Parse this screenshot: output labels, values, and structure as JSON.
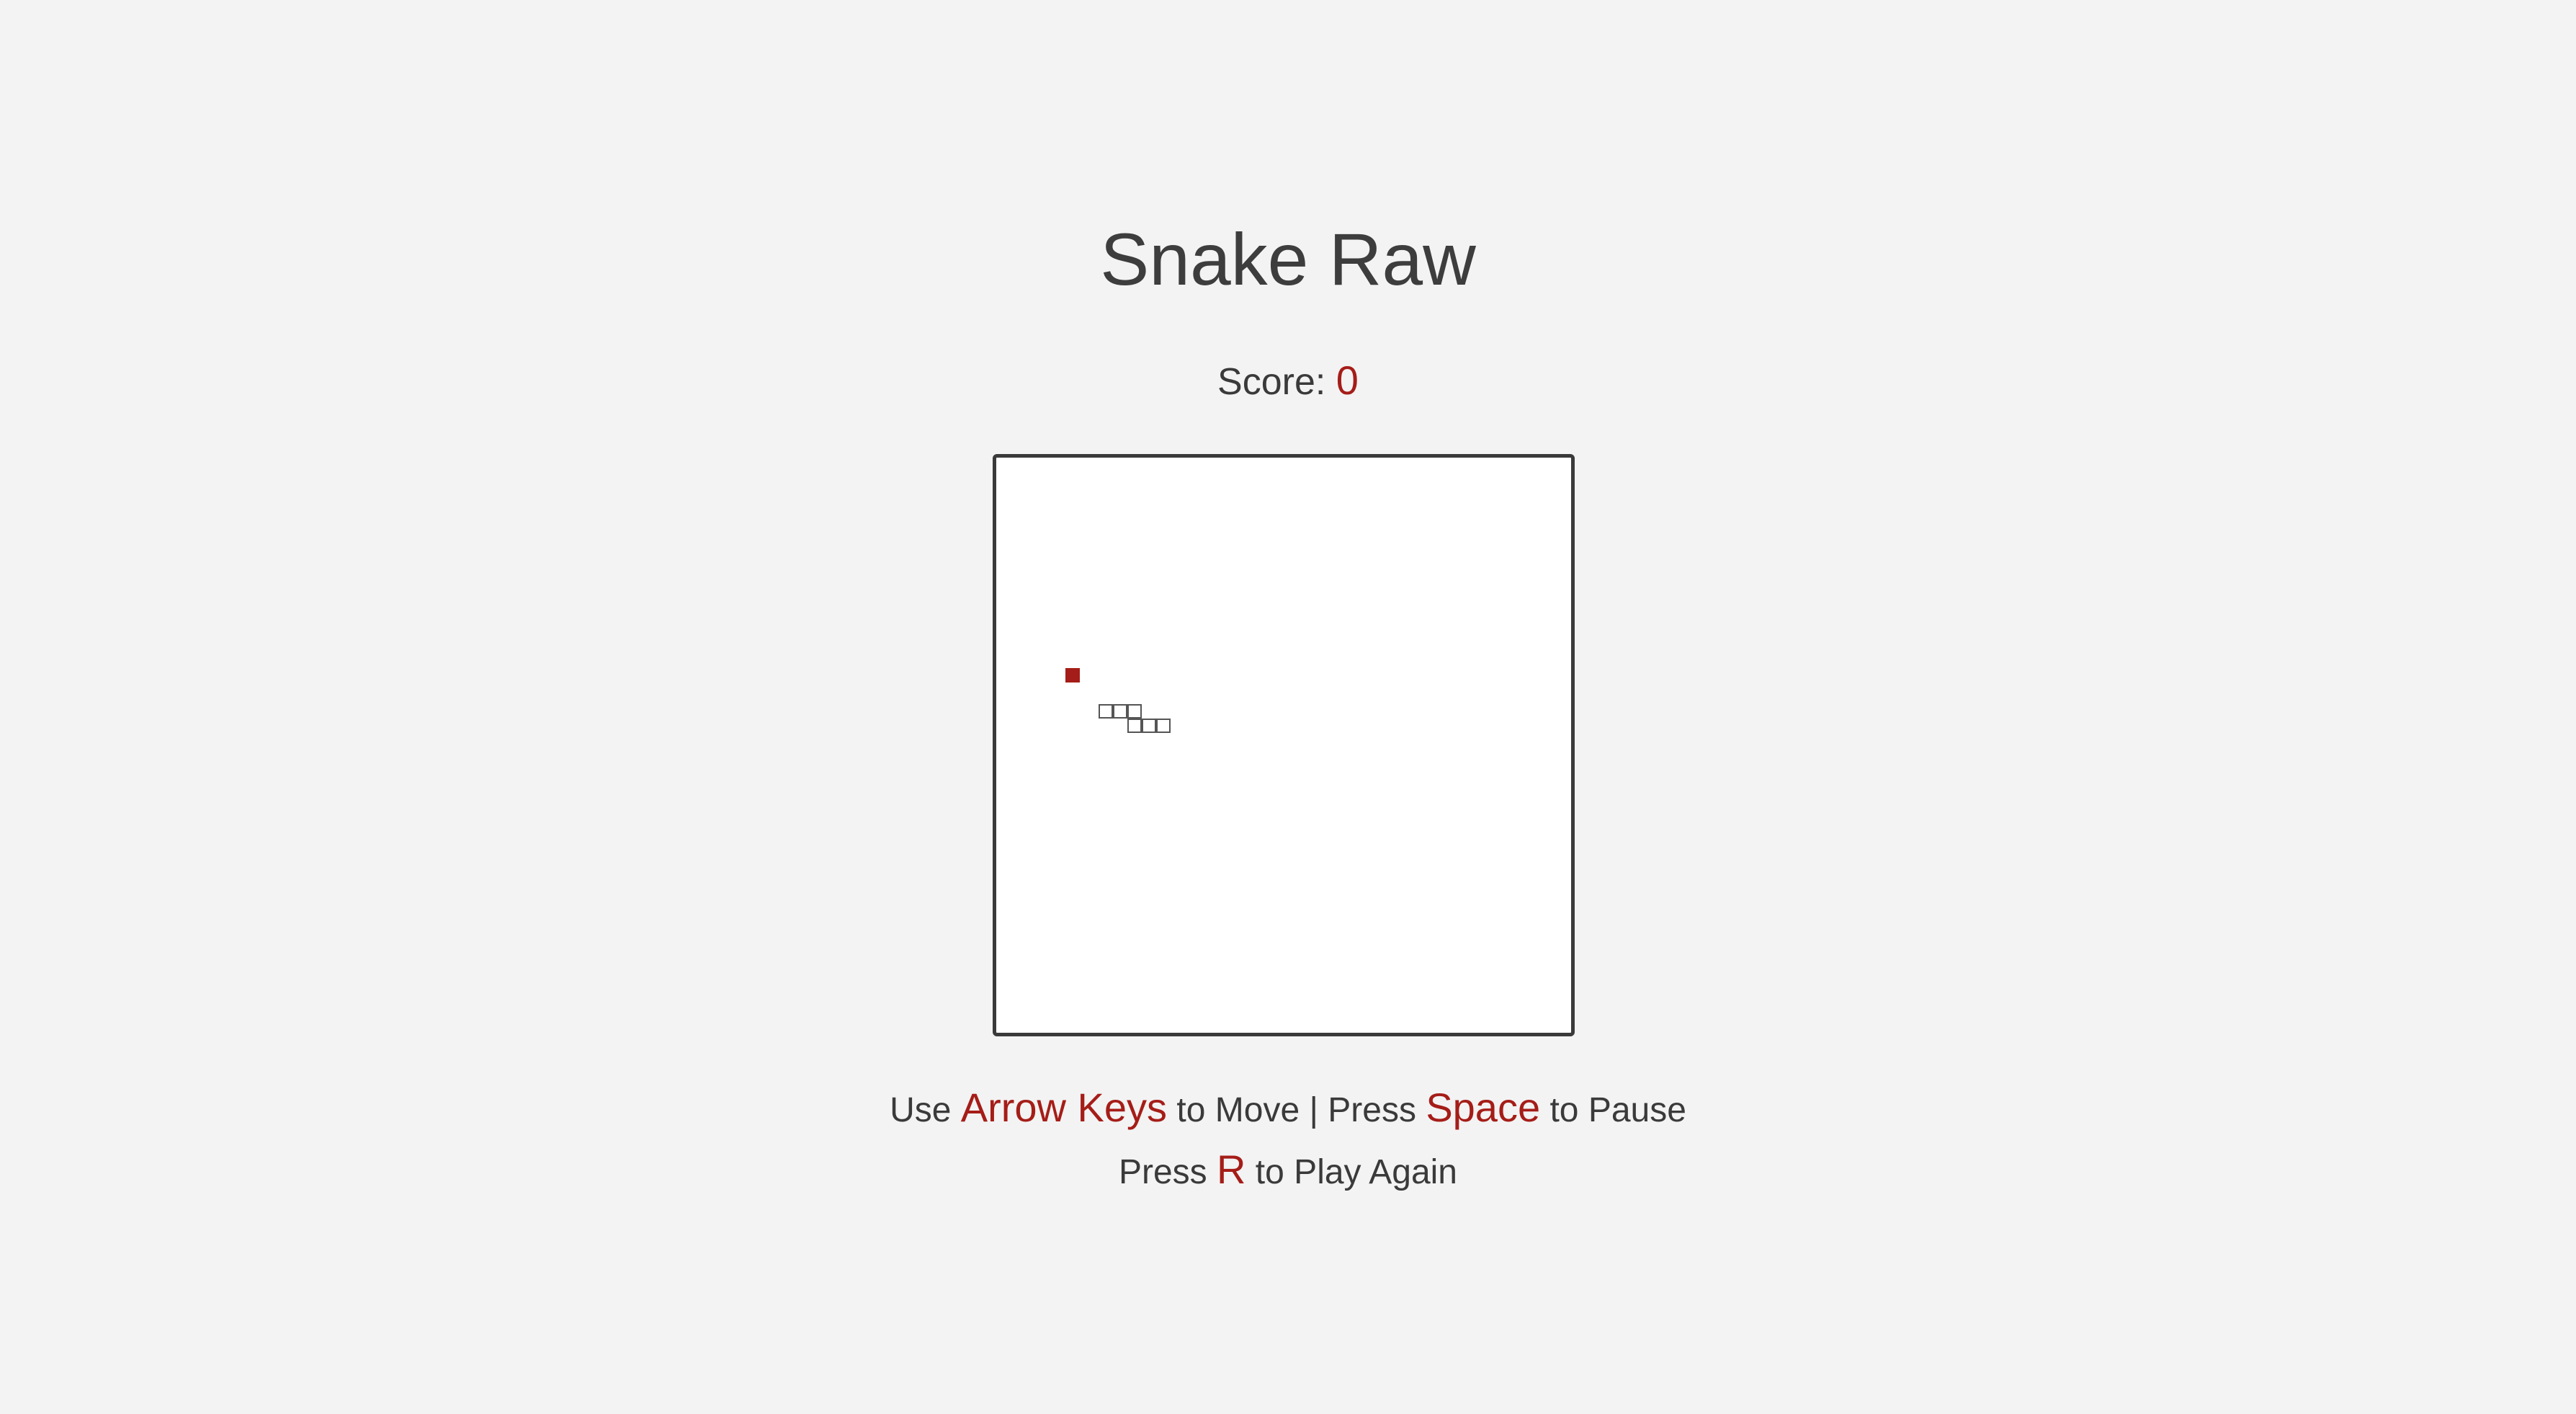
{
  "title": "Snake Raw",
  "score": {
    "label": "Score: ",
    "value": "0"
  },
  "board": {
    "grid_cell_px_note": "",
    "food": {
      "col": 5,
      "row": 14,
      "color": "#a51d18"
    },
    "snake": [
      {
        "col": 7,
        "row": 17
      },
      {
        "col": 8,
        "row": 17
      },
      {
        "col": 9,
        "row": 17
      },
      {
        "col": 9,
        "row": 18
      },
      {
        "col": 10,
        "row": 18
      },
      {
        "col": 11,
        "row": 18
      }
    ],
    "snake_color": "#555555"
  },
  "instructions": {
    "line1": {
      "part1": "Use ",
      "key1": "Arrow Keys",
      "part2": " to Move | Press ",
      "key2": "Space",
      "part3": " to Pause"
    },
    "line2": {
      "part1": "Press ",
      "key": "R",
      "part2": " to Play Again"
    }
  },
  "colors": {
    "background": "#f3f3f3",
    "accent": "#a51d18",
    "text": "#3a3a3a",
    "board": "#ffffff"
  }
}
